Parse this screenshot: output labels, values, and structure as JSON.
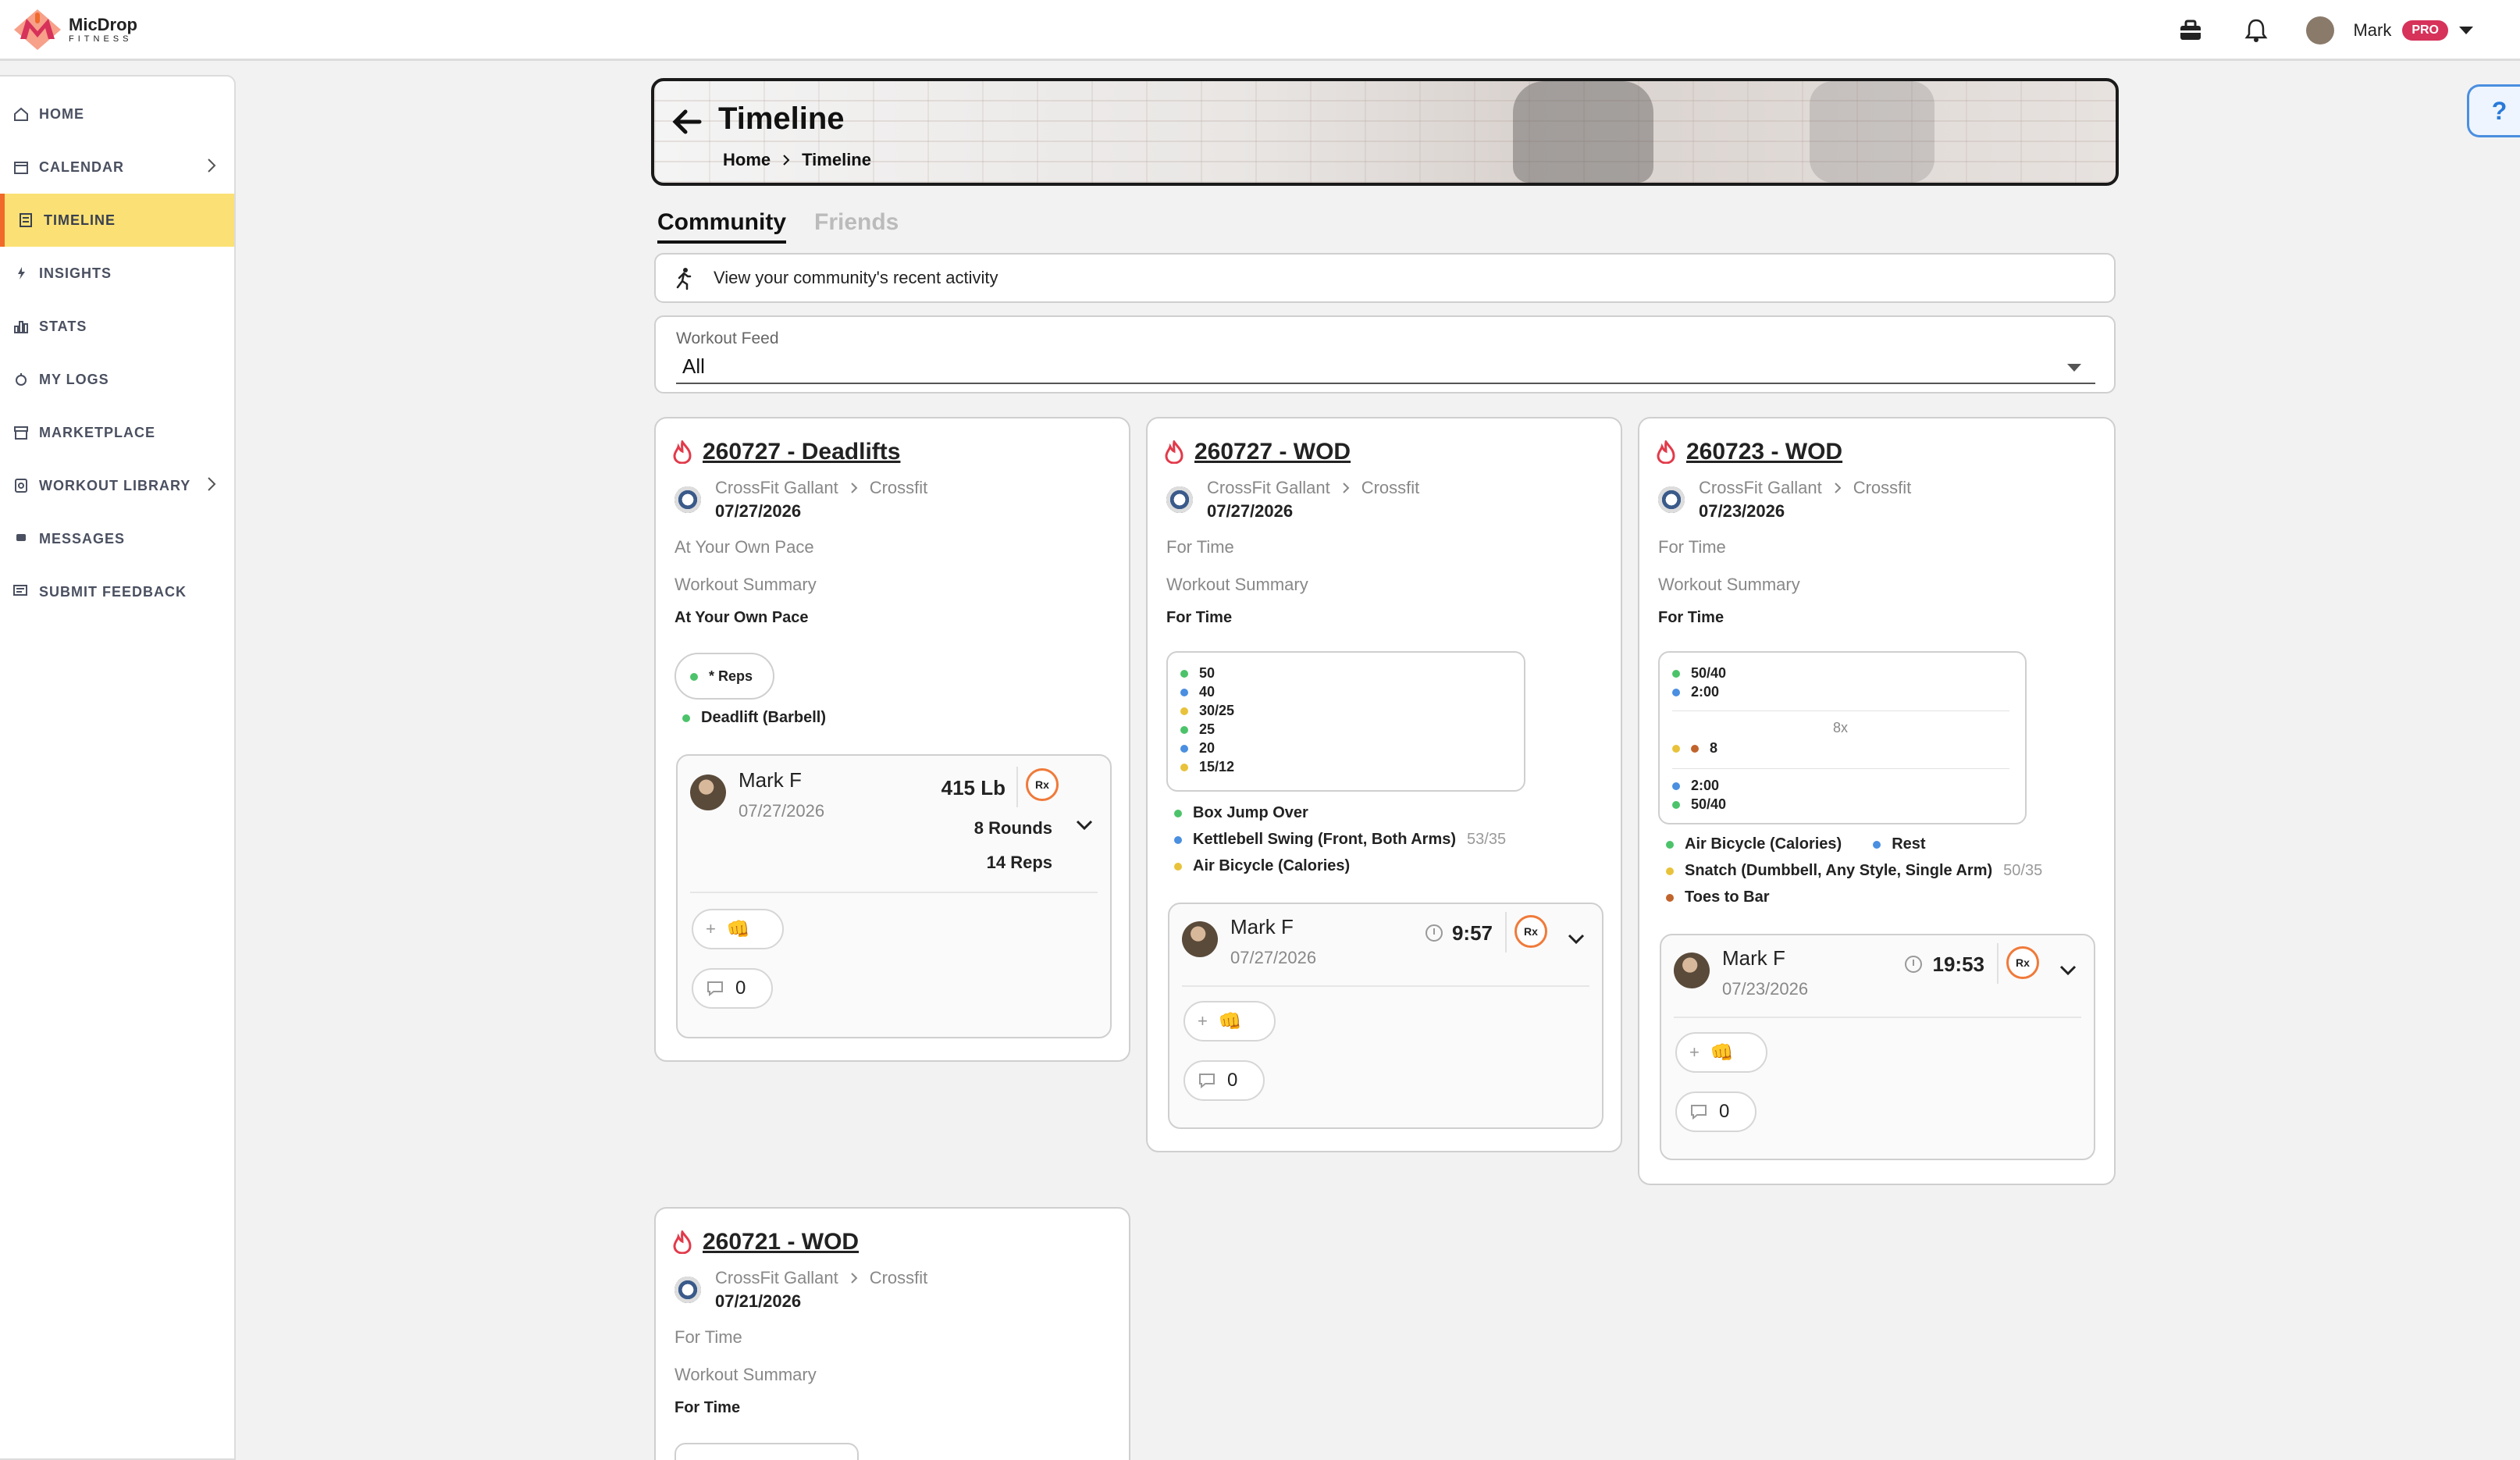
{
  "brand": {
    "name_line1": "MicDrop",
    "name_line2": "FITNESS"
  },
  "header": {
    "user_name": "Mark",
    "badge": "PRO"
  },
  "sidebar": {
    "items": [
      {
        "label": "HOME",
        "icon": "home-icon"
      },
      {
        "label": "CALENDAR",
        "icon": "calendar-icon",
        "has_chevron": true
      },
      {
        "label": "TIMELINE",
        "icon": "timeline-icon",
        "active": true
      },
      {
        "label": "INSIGHTS",
        "icon": "insights-icon"
      },
      {
        "label": "STATS",
        "icon": "stats-icon"
      },
      {
        "label": "MY LOGS",
        "icon": "logs-icon"
      },
      {
        "label": "MARKETPLACE",
        "icon": "marketplace-icon"
      },
      {
        "label": "WORKOUT LIBRARY",
        "icon": "library-icon",
        "has_chevron": true
      },
      {
        "label": "MESSAGES",
        "icon": "messages-icon"
      },
      {
        "label": "SUBMIT FEEDBACK",
        "icon": "feedback-icon"
      }
    ]
  },
  "help": {
    "label": "?"
  },
  "page": {
    "title": "Timeline",
    "breadcrumb": [
      "Home",
      "Timeline"
    ]
  },
  "tabs": [
    {
      "label": "Community",
      "active": true
    },
    {
      "label": "Friends",
      "active": false
    }
  ],
  "info_bar": {
    "text": "View your community's recent activity"
  },
  "feed_select": {
    "label": "Workout Feed",
    "value": "All"
  },
  "cards": [
    {
      "title": "260727 - Deadlifts",
      "gym": "CrossFit Gallant",
      "track": "Crossfit",
      "date": "07/27/2026",
      "style": "At Your Own Pace",
      "summary_label": "Workout Summary",
      "summary_value": "At Your Own Pace",
      "reps": [
        "* Reps"
      ],
      "movements": [
        {
          "name": "Deadlift (Barbell)",
          "color": "#4cc36a"
        }
      ],
      "result": {
        "name": "Mark F",
        "date": "07/27/2026",
        "value": "415 Lb",
        "sub1": "8 Rounds",
        "sub2": "14 Reps",
        "rx": "Rx",
        "comments": "0"
      }
    },
    {
      "title": "260727 - WOD",
      "gym": "CrossFit Gallant",
      "track": "Crossfit",
      "date": "07/27/2026",
      "style": "For Time",
      "summary_label": "Workout Summary",
      "summary_value": "For Time",
      "reps": [
        "50",
        "40",
        "30/25",
        "25",
        "20",
        "15/12"
      ],
      "movements": [
        {
          "name": "Box Jump Over",
          "color": "#4cc36a"
        },
        {
          "name": "Kettlebell Swing (Front, Both Arms)",
          "sub": "53/35",
          "color": "#4a8fe0"
        },
        {
          "name": "Air Bicycle (Calories)",
          "color": "#e8c23a"
        }
      ],
      "result": {
        "name": "Mark F",
        "date": "07/27/2026",
        "value": "9:57",
        "rx": "Rx",
        "comments": "0"
      }
    },
    {
      "title": "260723 - WOD",
      "gym": "CrossFit Gallant",
      "track": "Crossfit",
      "date": "07/23/2026",
      "style": "For Time",
      "summary_label": "Workout Summary",
      "summary_value": "For Time",
      "reps": [
        "50/40",
        "2:00",
        "8",
        "2:00",
        "50/40"
      ],
      "rounds": "8x",
      "movements": [
        {
          "name": "Air Bicycle (Calories)",
          "color": "#4cc36a"
        },
        {
          "name": "Rest",
          "color": "#4a8fe0"
        },
        {
          "name": "Snatch (Dumbbell, Any Style, Single Arm)",
          "sub": "50/35",
          "color": "#e8c23a"
        },
        {
          "name": "Toes to Bar",
          "color": "#c0642c"
        }
      ],
      "result": {
        "name": "Mark F",
        "date": "07/23/2026",
        "value": "19:53",
        "rx": "Rx",
        "comments": "0"
      }
    },
    {
      "title": "260721 - WOD",
      "gym": "CrossFit Gallant",
      "track": "Crossfit",
      "date": "07/21/2026",
      "style": "For Time",
      "summary_label": "Workout Summary",
      "summary_value": "For Time"
    }
  ]
}
